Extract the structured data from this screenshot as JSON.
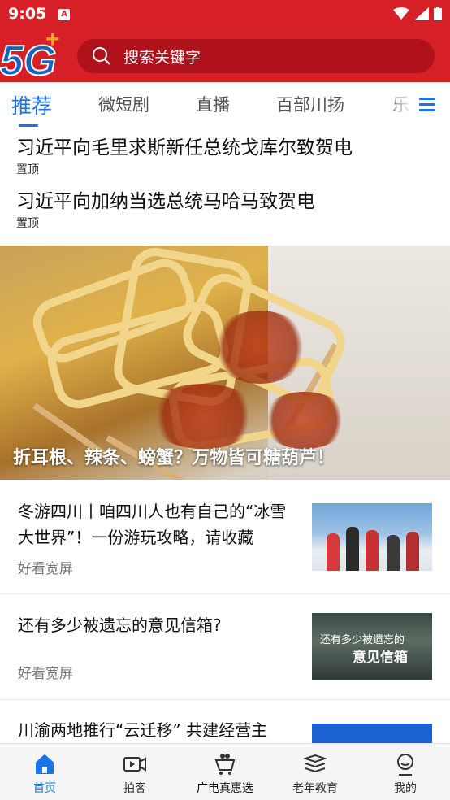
{
  "status_bar": {
    "time": "9:05",
    "badge": "A"
  },
  "header": {
    "logo_text": "5G+",
    "search_placeholder": "搜索关键字"
  },
  "tabs": [
    {
      "label": "推荐",
      "active": true
    },
    {
      "label": "微短剧",
      "active": false
    },
    {
      "label": "直播",
      "active": false
    },
    {
      "label": "百部川扬",
      "active": false
    },
    {
      "label": "乐",
      "active": false
    }
  ],
  "pinned": [
    {
      "title": "习近平向毛里求斯新任总统戈库尔致贺电",
      "tag": "置顶"
    },
    {
      "title": "习近平向加纳当选总统马哈马致贺电",
      "tag": "置顶"
    }
  ],
  "hero": {
    "caption": "折耳根、辣条、螃蟹？万物皆可糖葫芦！"
  },
  "news": [
    {
      "title": "冬游四川丨咱四川人也有自己的“冰雪大世界”！一份游玩攻略，请收藏",
      "source": "好看宽屏"
    },
    {
      "title": "还有多少被遗忘的意见信箱?",
      "source": "好看宽屏",
      "thumb_text_1": "还有多少被遗忘的",
      "thumb_text_2": "意见信箱"
    },
    {
      "title": "川渝两地推行“云迁移” 共建经营主",
      "source": ""
    }
  ],
  "bottom_nav": [
    {
      "label": "首页",
      "icon": "home-icon",
      "active": true
    },
    {
      "label": "拍客",
      "icon": "video-icon",
      "active": false
    },
    {
      "label": "广电真惠选",
      "icon": "shopping-cart-icon",
      "active": false
    },
    {
      "label": "老年教育",
      "icon": "books-icon",
      "active": false
    },
    {
      "label": "我的",
      "icon": "profile-icon",
      "active": false
    }
  ],
  "colors": {
    "brand_red": "#d61f26",
    "accent_blue": "#1a73e8"
  }
}
